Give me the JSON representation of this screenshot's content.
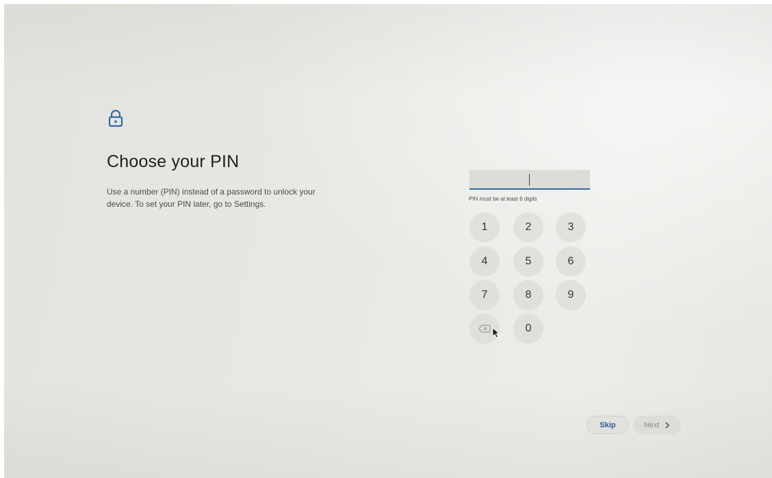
{
  "page": {
    "title": "Choose your PIN",
    "description": "Use a number (PIN) instead of a password to unlock your device. To set your PIN later, go to Settings."
  },
  "pin": {
    "value": "",
    "hint": "PIN must be at least 6 digits"
  },
  "keypad": {
    "keys": [
      "1",
      "2",
      "3",
      "4",
      "5",
      "6",
      "7",
      "8",
      "9",
      "0"
    ],
    "backspace_icon": "backspace-icon"
  },
  "buttons": {
    "skip": "Skip",
    "next": "Next"
  },
  "icons": {
    "lock": "lock-icon",
    "next_chevron": "chevron-right-icon",
    "pointer": "mouse-pointer-icon"
  },
  "colors": {
    "accent": "#2f6aa8",
    "skip_text": "#2a5d92",
    "next_text": "#8a8a8a"
  }
}
